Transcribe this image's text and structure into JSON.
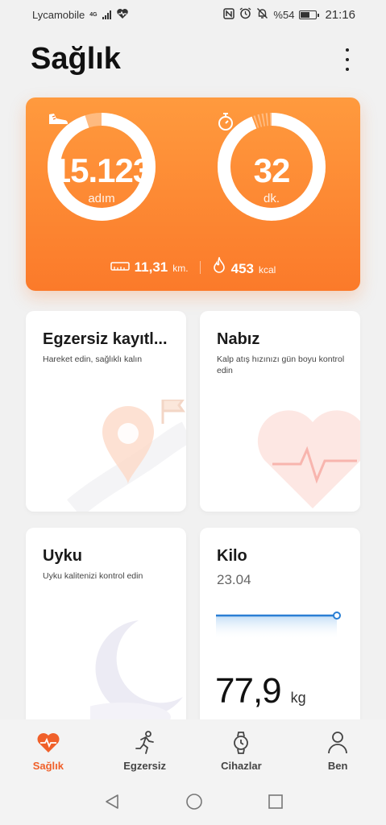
{
  "status_bar": {
    "carrier": "Lycamobile",
    "network": "4G",
    "battery": "%54",
    "time": "21:16",
    "icons": [
      "signal-icon",
      "heart-rate-icon",
      "nfc-icon",
      "alarm-icon",
      "mute-icon",
      "battery-icon"
    ]
  },
  "header": {
    "title": "Sağlık",
    "menu_icon": "more-vertical-icon"
  },
  "summary": {
    "steps": {
      "value": "15.123",
      "unit": "adım",
      "icon": "shoe-icon",
      "progress": 0.95
    },
    "minutes": {
      "value": "32",
      "unit": "dk.",
      "icon": "stopwatch-icon",
      "progress": 0.94
    },
    "distance": {
      "value": "11,31",
      "unit": "km.",
      "icon": "ruler-icon"
    },
    "calories": {
      "value": "453",
      "unit": "kcal",
      "icon": "flame-icon"
    }
  },
  "cards": {
    "exercise": {
      "title": "Egzersiz kayıtl...",
      "subtitle": "Hareket edin, sağlıklı kalın",
      "icon": "location-pin-icon"
    },
    "heart": {
      "title": "Nabız",
      "subtitle": "Kalp atış hızınızı gün boyu kontrol edin",
      "icon": "heart-icon"
    },
    "sleep": {
      "title": "Uyku",
      "subtitle": "Uyku kalitenizi kontrol edin",
      "icon": "moon-icon"
    },
    "weight": {
      "title": "Kilo",
      "date": "23.04",
      "value": "77,9",
      "unit": "kg"
    }
  },
  "bottom_nav": [
    {
      "label": "Sağlık",
      "icon": "heart-pulse-icon",
      "active": true
    },
    {
      "label": "Egzersiz",
      "icon": "running-icon",
      "active": false
    },
    {
      "label": "Cihazlar",
      "icon": "watch-icon",
      "active": false
    },
    {
      "label": "Ben",
      "icon": "person-icon",
      "active": false
    }
  ],
  "system_nav": [
    "back-icon",
    "home-icon",
    "recents-icon"
  ],
  "colors": {
    "accent": "#f0602a",
    "card_gradient_top": "#ff9a3e",
    "card_gradient_bottom": "#fb7a2a",
    "chart_line": "#2a7fd4"
  }
}
